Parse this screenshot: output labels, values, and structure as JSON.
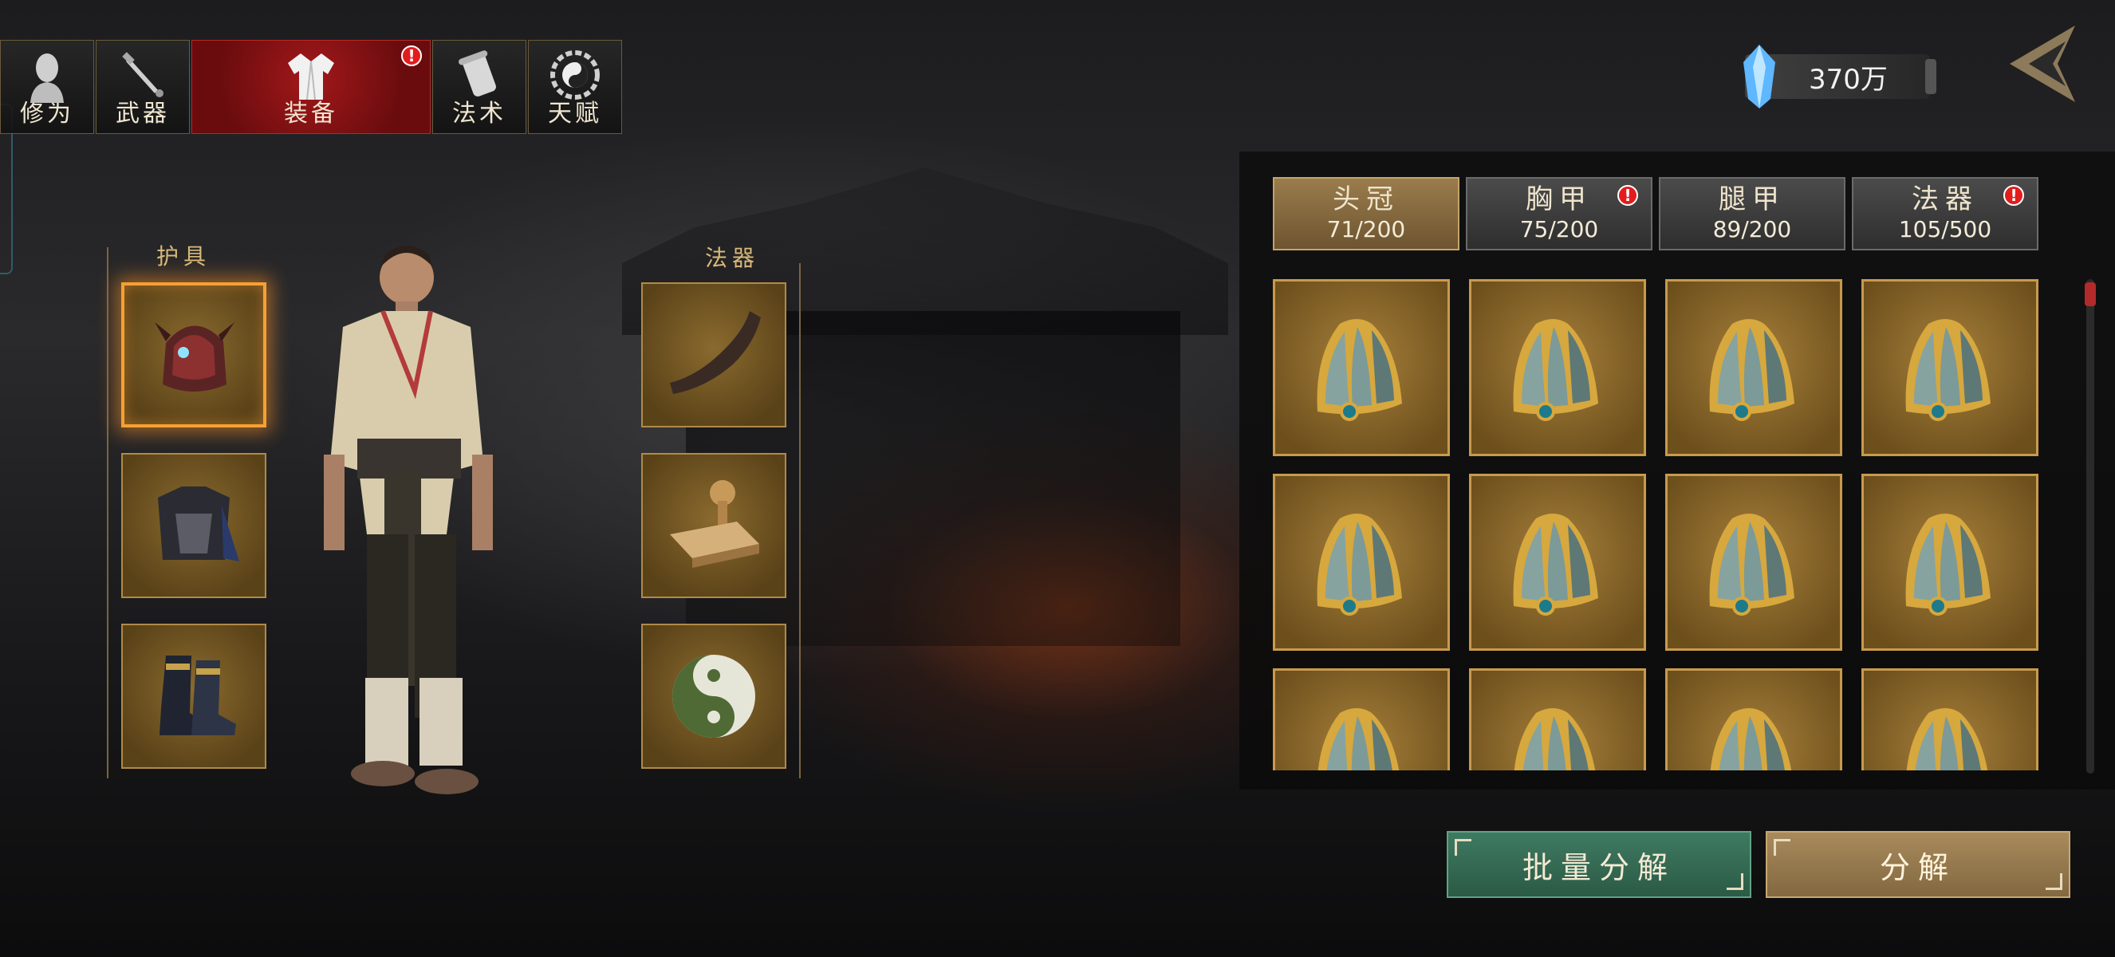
{
  "nav": {
    "tabs": [
      {
        "label": "修为",
        "icon": "cultivation-head-icon",
        "alert": false
      },
      {
        "label": "武器",
        "icon": "sword-icon",
        "alert": false
      },
      {
        "label": "装备",
        "icon": "robe-icon",
        "alert": true,
        "active": true
      },
      {
        "label": "法术",
        "icon": "scroll-icon",
        "alert": false
      },
      {
        "label": "天赋",
        "icon": "bagua-icon",
        "alert": false
      }
    ],
    "alert_mark": "!"
  },
  "currency": {
    "icon": "blue-crystal-icon",
    "amount": "370万"
  },
  "back_icon": "back-arrow-icon",
  "equipment": {
    "armor_label": "护具",
    "artifact_label": "法器",
    "armor_slots": [
      {
        "item": "demon-helmet",
        "selected": true
      },
      {
        "item": "chest-armor",
        "selected": false
      },
      {
        "item": "boots",
        "selected": false
      }
    ],
    "artifact_slots": [
      {
        "item": "horn"
      },
      {
        "item": "seal-stamp"
      },
      {
        "item": "yin-yang-disc"
      }
    ]
  },
  "categories": [
    {
      "name": "头冠",
      "count": "71/200",
      "active": true,
      "alert": false
    },
    {
      "name": "胸甲",
      "count": "75/200",
      "active": false,
      "alert": true
    },
    {
      "name": "腿甲",
      "count": "89/200",
      "active": false,
      "alert": false
    },
    {
      "name": "法器",
      "count": "105/500",
      "active": false,
      "alert": true
    }
  ],
  "inventory": {
    "item_icon": "jade-crown-icon",
    "visible_rows": 3,
    "columns": 4
  },
  "buttons": {
    "batch_decompose": "批量分解",
    "decompose": "分解"
  },
  "colors": {
    "active_tab": "#a3181a",
    "alert": "#e31c1c",
    "slot_gold": "#b08a48",
    "batch_green": "#3f7a62"
  }
}
